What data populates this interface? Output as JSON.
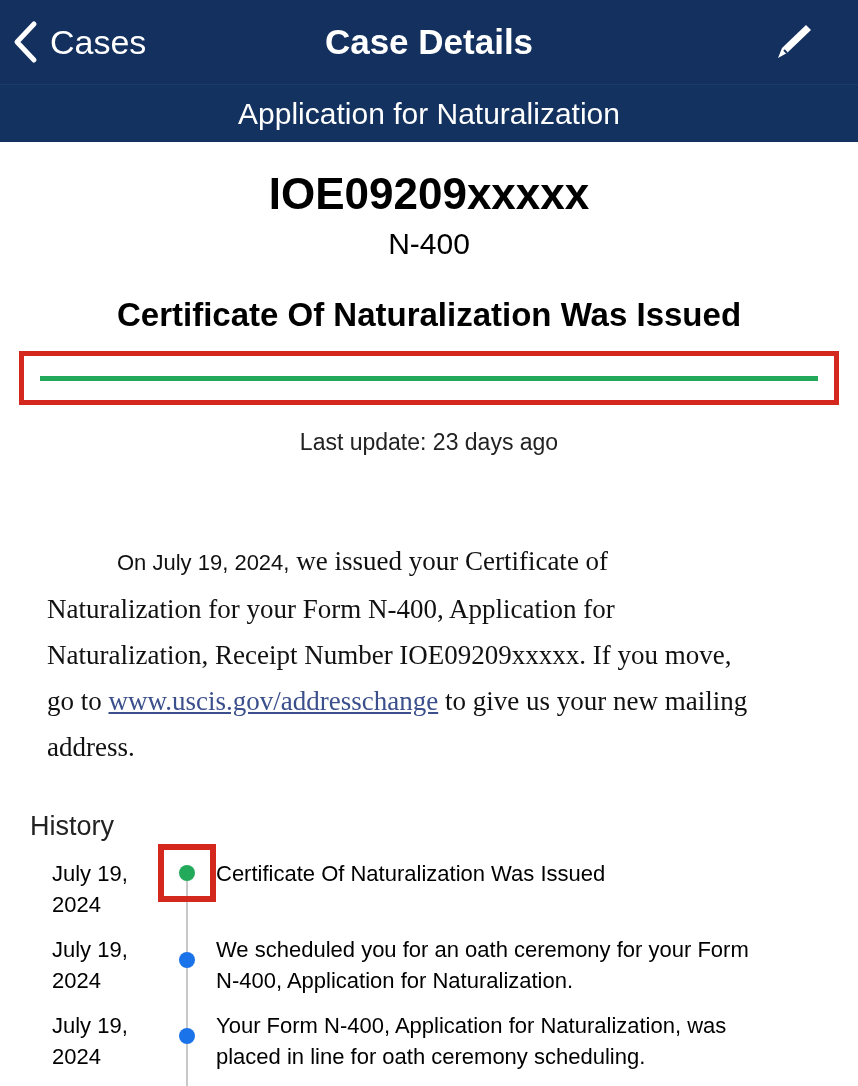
{
  "nav_bar": {
    "back_label": "Cases",
    "title": "Case Details"
  },
  "subtitle": "Application for Naturalization",
  "case": {
    "receipt_number": "IOE09209xxxxx",
    "form": "N-400",
    "status": "Certificate Of Naturalization Was Issued",
    "progress": {
      "level": 1,
      "highlighted": true
    },
    "last_update": "Last update: 23 days ago"
  },
  "description": [
    {
      "kind": "lead",
      "text": "On July 19, 2024,"
    },
    {
      "kind": "text",
      "text": " we issued your Certificate of Naturalization for your Form N-400, Application for Naturalization, Receipt Number IOE09209xxxxx. If you move, go to "
    },
    {
      "kind": "link",
      "text": "www.uscis.gov/addresschange"
    },
    {
      "kind": "text",
      "text": " to give us your new mailing address."
    }
  ],
  "history": {
    "title": "History",
    "items": [
      {
        "date": "July 19, 2024",
        "text": "Certificate Of Naturalization Was Issued",
        "color": "#22a95a",
        "highlighted": true
      },
      {
        "date": "July 19, 2024",
        "text": "We scheduled you for an oath ceremony for your Form N-400, Application for Naturalization.",
        "color": "#1a73e8",
        "highlighted": false
      },
      {
        "date": "July 19, 2024",
        "text": "Your Form N-400, Application for Naturalization, was placed in line for oath ceremony scheduling.",
        "color": "#1a73e8",
        "highlighted": false
      }
    ]
  }
}
